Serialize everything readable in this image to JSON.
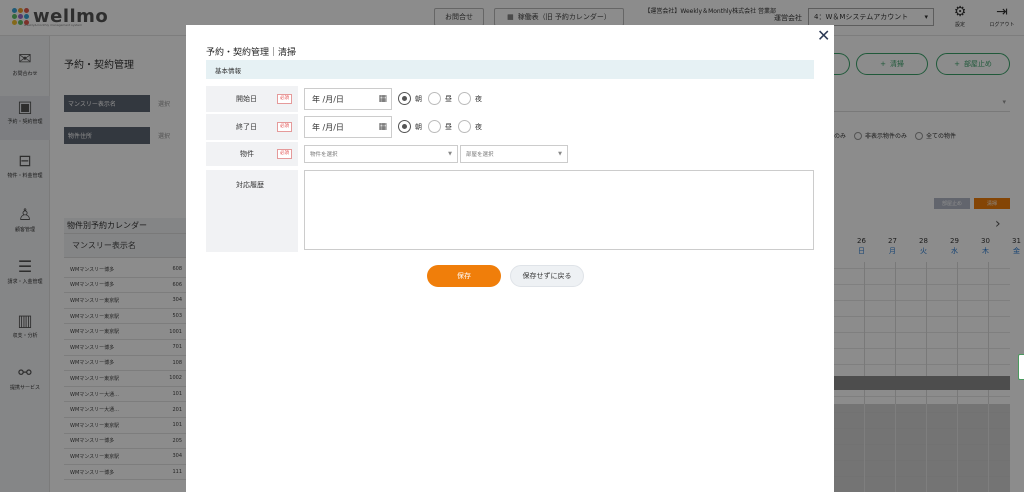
{
  "header": {
    "logo": "wellmo",
    "logo_tagline": "weekly&monthly management system",
    "logo_colors": [
      "#3aa4d8",
      "#f0a030",
      "#e25c4f",
      "#5fbf6b",
      "#9b6cc8",
      "#3aa4d8",
      "#f0c030",
      "#5fbf6b",
      "#e25c4f"
    ],
    "contact_btn": "お問合せ",
    "calendar_btn": "稼働表（旧 予約カレンダー）",
    "company": "【運営会社】Weekly＆Monthly株式会社 営業部",
    "operator_label": "運営会社",
    "operator_value": "4：W＆Mシステムアカウント",
    "settings_label": "設定",
    "logout_label": "ログアウト"
  },
  "sidebar": {
    "items": [
      {
        "label": "お問合わせ",
        "icon": "mail-icon"
      },
      {
        "label": "予約・契約管理",
        "icon": "calendar-icon"
      },
      {
        "label": "物件・料金管理",
        "icon": "bed-icon"
      },
      {
        "label": "顧客管理",
        "icon": "person-icon"
      },
      {
        "label": "請求・入金管理",
        "icon": "invoice-icon"
      },
      {
        "label": "収支・分析",
        "icon": "chart-icon"
      },
      {
        "label": "提携サービス",
        "icon": "network-icon"
      }
    ]
  },
  "background_page": {
    "title": "予約・契約管理",
    "filter_monthly_label": "マンスリー表示名",
    "filter_property_label": "物件住所",
    "filter_placeholder": "選択",
    "cleaning_btn": "清掃",
    "block_btn": "部屋止め",
    "radio_options": [
      "のみ",
      "非表示物件のみ",
      "全ての物件"
    ],
    "mini_btn_a": "部屋止め",
    "mini_btn_b": "清掃",
    "calendar_title": "物件別予約カレンダー",
    "calendar_col": "マンスリー表示名",
    "next_arrow": "›",
    "days": [
      {
        "d": "26",
        "w": "日"
      },
      {
        "d": "27",
        "w": "月"
      },
      {
        "d": "28",
        "w": "火"
      },
      {
        "d": "29",
        "w": "水"
      },
      {
        "d": "30",
        "w": "木"
      },
      {
        "d": "31",
        "w": "金"
      }
    ],
    "rows": [
      {
        "name": "WMマンスリー博多",
        "room": "608"
      },
      {
        "name": "WMマンスリー博多",
        "room": "606"
      },
      {
        "name": "WMマンスリー東京駅",
        "room": "304"
      },
      {
        "name": "WMマンスリー東京駅",
        "room": "503"
      },
      {
        "name": "WMマンスリー東京駅",
        "room": "1001"
      },
      {
        "name": "WMマンスリー博多",
        "room": "701"
      },
      {
        "name": "WMマンスリー博多",
        "room": "108"
      },
      {
        "name": "WMマンスリー東京駅",
        "room": "1002"
      },
      {
        "name": "WMマンスリー大通...",
        "room": "101"
      },
      {
        "name": "WMマンスリー大通...",
        "room": "201"
      },
      {
        "name": "WMマンスリー東京駅",
        "room": "101"
      },
      {
        "name": "WMマンスリー博多",
        "room": "205"
      },
      {
        "name": "WMマンスリー東京駅",
        "room": "304"
      },
      {
        "name": "WMマンスリー博多",
        "room": "111"
      }
    ]
  },
  "modal": {
    "title": "予約・契約管理｜清掃",
    "close": "✕",
    "section": "基本情報",
    "required_badge": "必須",
    "start_label": "開始日",
    "end_label": "終了日",
    "property_label": "物件",
    "history_label": "対応履歴",
    "date_placeholder": "年 /月/日",
    "radio_morning": "朝",
    "radio_noon": "昼",
    "radio_night": "夜",
    "start_time_selected": "朝",
    "end_time_selected": "朝",
    "property_placeholder": "物件を選択",
    "room_placeholder": "部屋を選択",
    "history_value": "",
    "save_btn": "保存",
    "back_btn": "保存せずに戻る"
  }
}
